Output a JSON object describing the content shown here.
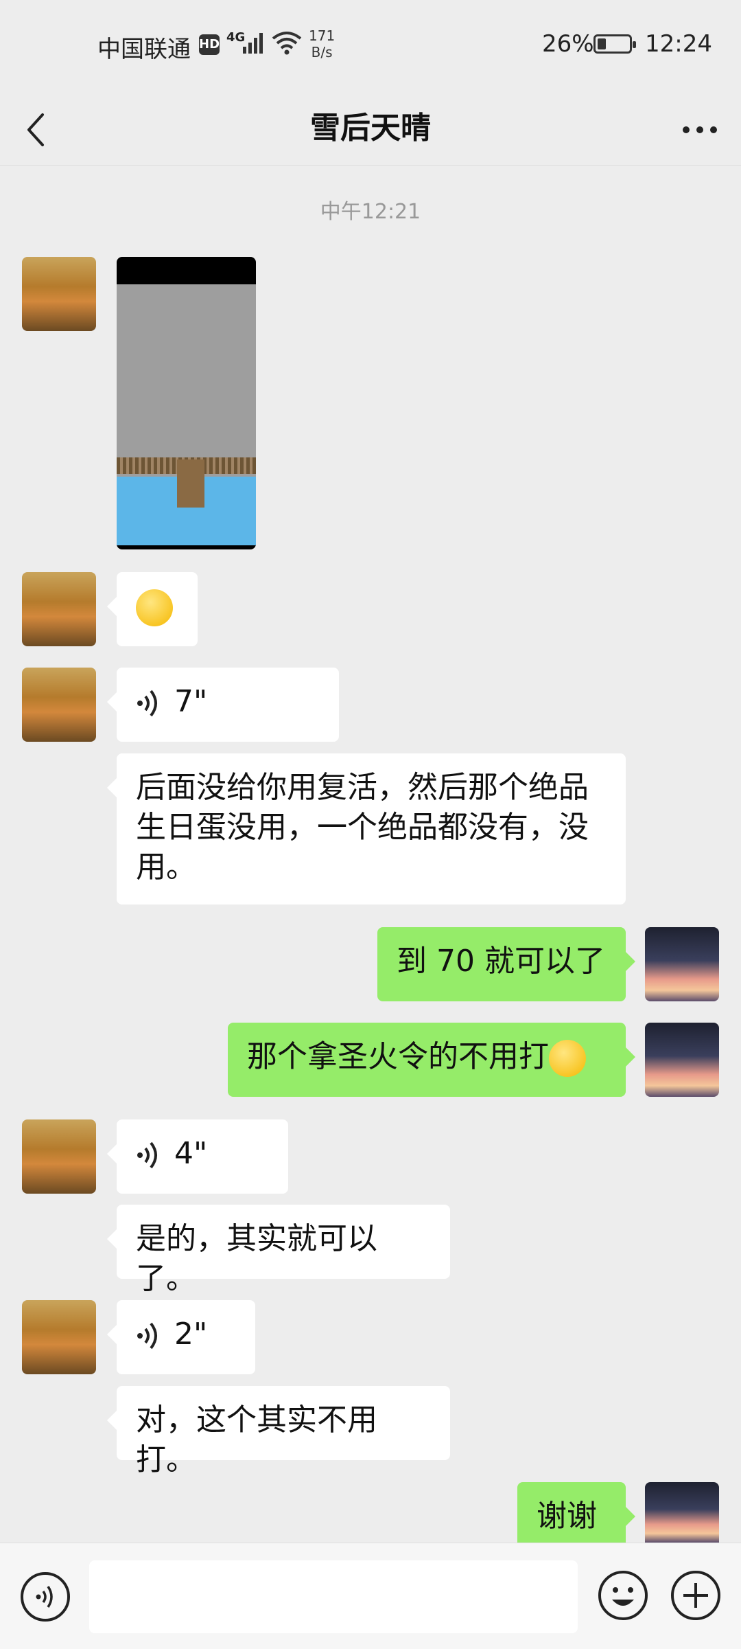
{
  "status_bar": {
    "carrier": "中国联通",
    "hd": "HD",
    "network": "4G",
    "speed_value": "171",
    "speed_unit": "B/s",
    "battery_percent": "26%",
    "time": "12:24"
  },
  "header": {
    "title": "雪后天晴"
  },
  "timestamp": "中午12:21",
  "messages": [
    {
      "sender": "other",
      "type": "image"
    },
    {
      "sender": "other",
      "type": "emoji"
    },
    {
      "sender": "other",
      "type": "voice",
      "duration": "7\""
    },
    {
      "sender": "other",
      "type": "text",
      "text": "后面没给你用复活，然后那个绝品生日蛋没用，一个绝品都没有，没用。"
    },
    {
      "sender": "me",
      "type": "text",
      "text": "到 70 就可以了"
    },
    {
      "sender": "me",
      "type": "text",
      "text": "那个拿圣火令的不用打"
    },
    {
      "sender": "other",
      "type": "voice",
      "duration": "4\""
    },
    {
      "sender": "other",
      "type": "text",
      "text": "是的，其实就可以了。"
    },
    {
      "sender": "other",
      "type": "voice",
      "duration": "2\""
    },
    {
      "sender": "other",
      "type": "text",
      "text": "对，这个其实不用打。"
    },
    {
      "sender": "me",
      "type": "text",
      "text": "谢谢"
    }
  ],
  "colors": {
    "background": "#ededed",
    "my_bubble": "#95ec69",
    "other_bubble": "#ffffff"
  },
  "icons": [
    "back-icon",
    "more-icon",
    "voice-icon",
    "emoji-icon",
    "plus-icon"
  ]
}
